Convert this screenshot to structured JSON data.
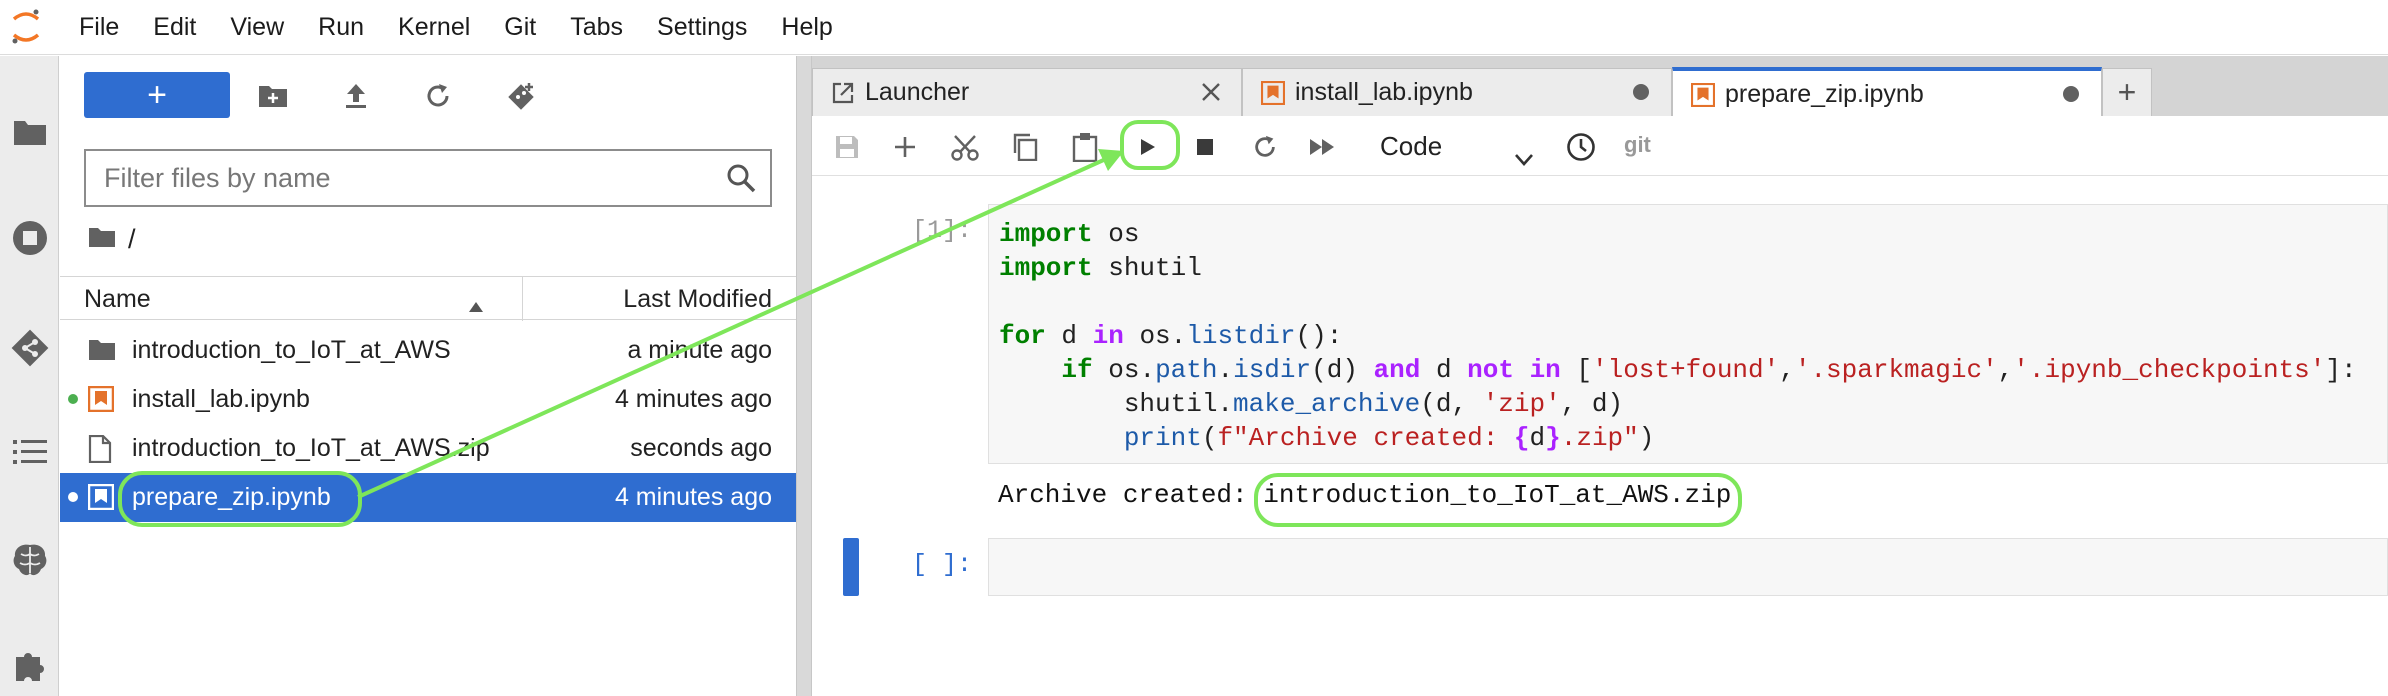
{
  "menu": [
    "File",
    "Edit",
    "View",
    "Run",
    "Kernel",
    "Git",
    "Tabs",
    "Settings",
    "Help"
  ],
  "filebrowser": {
    "new_label": "+",
    "filter_placeholder": "Filter files by name",
    "path": "/",
    "col_name": "Name",
    "col_modified": "Last Modified",
    "files": [
      {
        "name": "introduction_to_IoT_at_AWS",
        "modified": "a minute ago",
        "type": "folder"
      },
      {
        "name": "install_lab.ipynb",
        "modified": "4 minutes ago",
        "type": "notebook",
        "running": true
      },
      {
        "name": "introduction_to_IoT_at_AWS.zip",
        "modified": "seconds ago",
        "type": "file"
      },
      {
        "name": "prepare_zip.ipynb",
        "modified": "4 minutes ago",
        "type": "notebook",
        "running": true,
        "selected": true
      }
    ]
  },
  "tabs": [
    {
      "label": "Launcher",
      "icon": "launcher-icon",
      "close": "close-icon"
    },
    {
      "label": "install_lab.ipynb",
      "icon": "notebook-icon",
      "close": "unsaved-dot"
    },
    {
      "label": "prepare_zip.ipynb",
      "icon": "notebook-icon",
      "close": "unsaved-dot",
      "active": true
    }
  ],
  "tab_add_label": "+",
  "toolbar": {
    "cell_type": "Code",
    "git_label": "git"
  },
  "cells": [
    {
      "prompt": "[1]:",
      "output": "Archive created: introduction_to_IoT_at_AWS.zip"
    },
    {
      "prompt": "[ ]:"
    }
  ],
  "colors": {
    "accent": "#2f6dd0",
    "annotation": "#7ee65a",
    "notebook_orange": "#e4722b",
    "running_dot": "#4caf50"
  }
}
